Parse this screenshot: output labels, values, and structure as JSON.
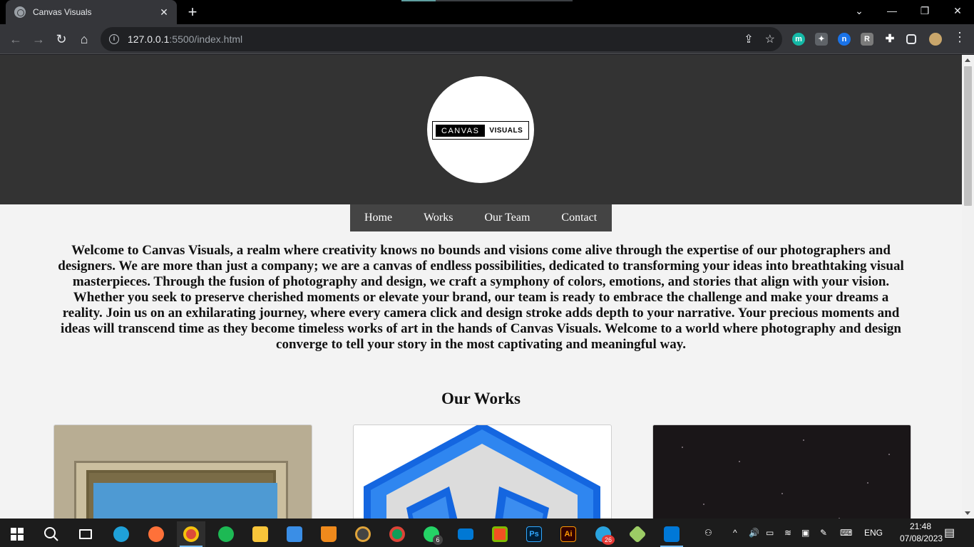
{
  "browser": {
    "tab_title": "Canvas Visuals",
    "tab_close": "✕",
    "new_tab": "+",
    "url_host": "127.0.0.1",
    "url_path": ":5500/index.html"
  },
  "site": {
    "logo": {
      "dark_word": "CANVAS",
      "light_word": "VISUALS"
    },
    "nav": [
      "Home",
      "Works",
      "Our Team",
      "Contact"
    ],
    "intro": "Welcome to Canvas Visuals, a realm where creativity knows no bounds and visions come alive through the expertise of our photographers and designers. We are more than just a company; we are a canvas of endless possibilities, dedicated to transforming your ideas into breathtaking visual masterpieces. Through the fusion of photography and design, we craft a symphony of colors, emotions, and stories that align with your vision. Whether you seek to preserve cherished moments or elevate your brand, our team is ready to embrace the challenge and make your dreams a reality. Join us on an exhilarating journey, where every camera click and design stroke adds depth to your narrative. Your precious moments and ideas will transcend time as they become timeless works of art in the hands of Canvas Visuals. Welcome to a world where photography and design converge to tell your story in the most captivating and meaningful way.",
    "works_title": "Our Works"
  },
  "taskbar": {
    "lang": "ENG",
    "time": "21:48",
    "date": "07/08/2023",
    "whatsapp_badge": "6",
    "telegram_badge": "26"
  },
  "colors": {
    "header_bg": "#333333",
    "nav_bg": "#444444",
    "page_bg": "#f3f3f3"
  }
}
